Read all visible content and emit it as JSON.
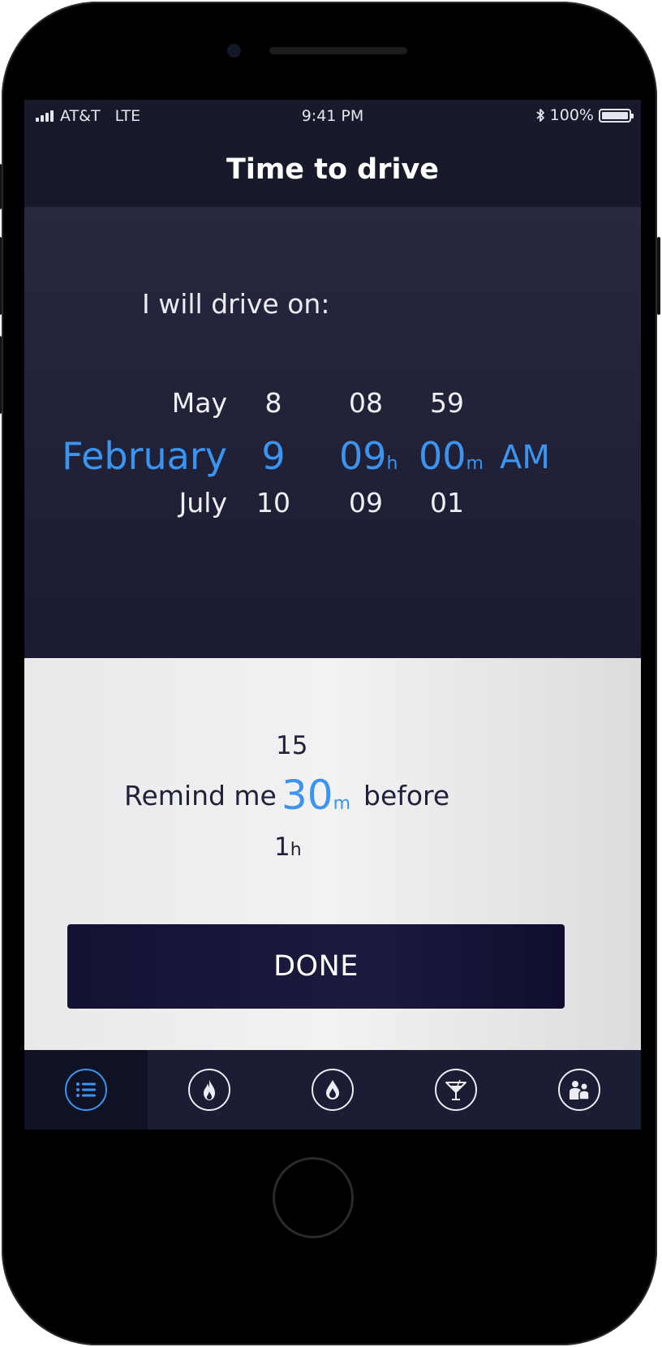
{
  "status_bar": {
    "carrier": "AT&T",
    "network": "LTE",
    "time": "9:41 PM",
    "battery_percent": "100%"
  },
  "nav": {
    "title": "Time to drive"
  },
  "drive_picker": {
    "prompt": "I will drive on:",
    "month": {
      "above": "May",
      "selected": "February",
      "below": "July"
    },
    "day": {
      "above": "8",
      "selected": "9",
      "below": "10"
    },
    "hour": {
      "above": "08",
      "selected": "09",
      "selected_unit": "h",
      "below": "09"
    },
    "minute": {
      "above": "59",
      "selected": "00",
      "selected_unit": "m",
      "below": "01"
    },
    "period": {
      "selected": "AM"
    }
  },
  "reminder": {
    "prefix": "Remind me",
    "suffix": "before",
    "above": "15",
    "selected": "30",
    "selected_unit": "m",
    "below": "1",
    "below_unit": "h"
  },
  "done_label": "DONE",
  "tabs": [
    {
      "icon": "list-icon",
      "active": true
    },
    {
      "icon": "flame-icon",
      "active": false
    },
    {
      "icon": "drop-icon",
      "active": false
    },
    {
      "icon": "cocktail-icon",
      "active": false
    },
    {
      "icon": "people-icon",
      "active": false
    }
  ],
  "colors": {
    "accent": "#3b95f0",
    "dark_panel": "#1b1b31",
    "light_panel": "#efeff0",
    "button": "#141236"
  }
}
